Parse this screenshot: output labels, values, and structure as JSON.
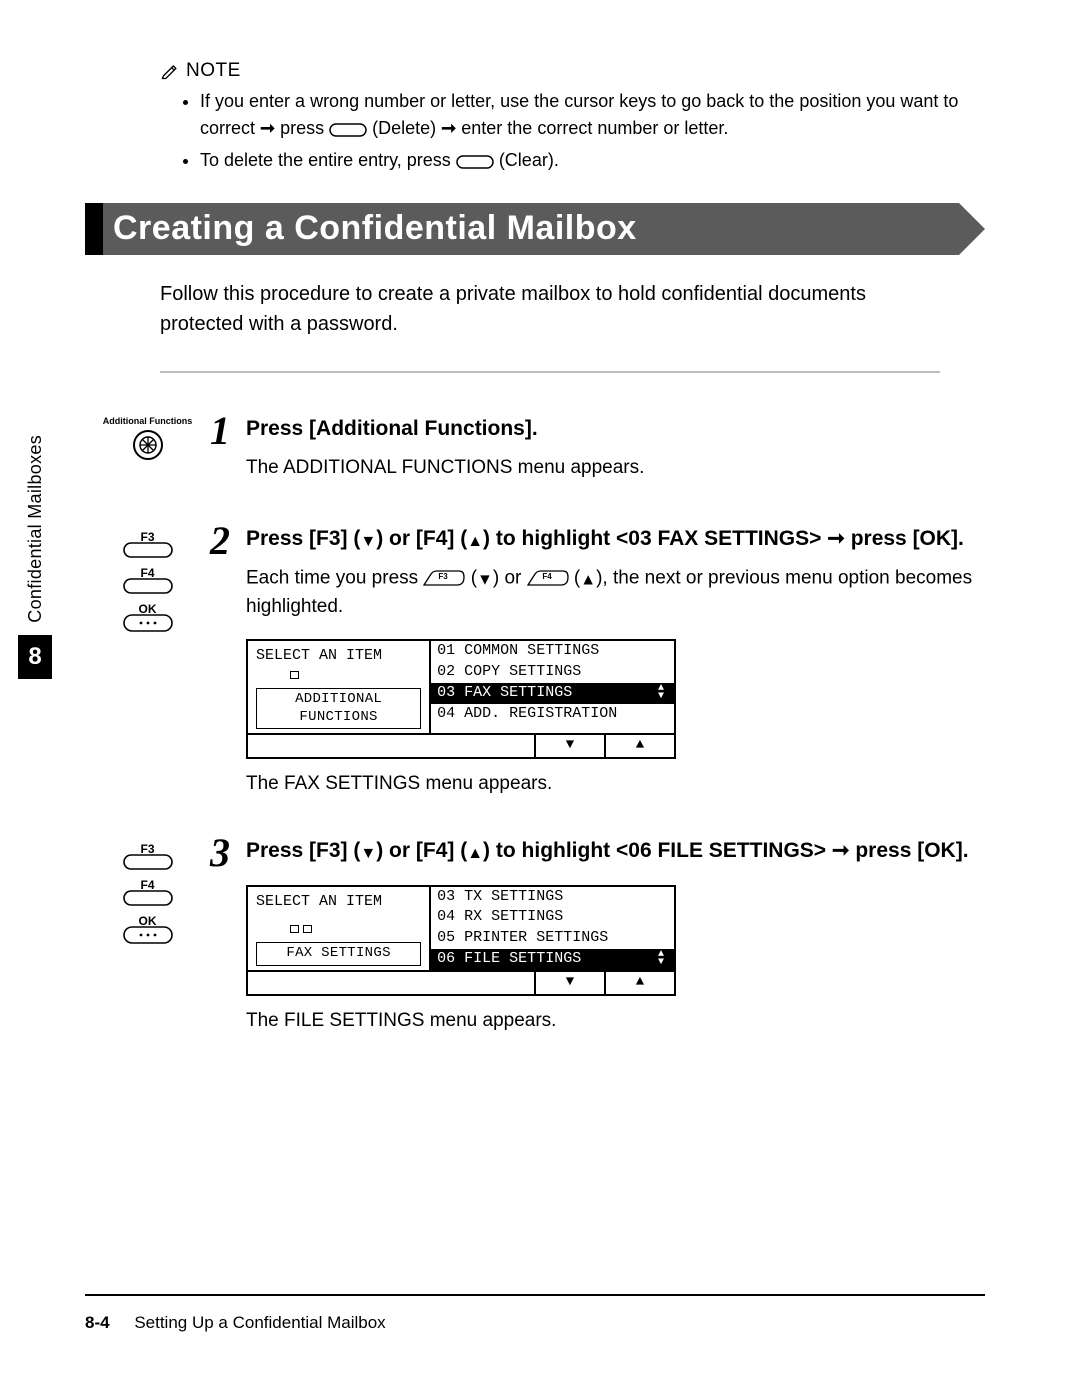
{
  "note": {
    "label": "NOTE",
    "bullet1_a": "If you enter a wrong number or letter, use the cursor keys to go back to the position you want to correct ",
    "bullet1_b": " press ",
    "bullet1_c": " (Delete) ",
    "bullet1_d": " enter the correct number or letter.",
    "bullet2_a": "To delete the entire entry, press ",
    "bullet2_b": " (Clear)."
  },
  "section_title": "Creating a Confidential Mailbox",
  "intro": "Follow this procedure to create a private mailbox to hold confidential documents protected with a password.",
  "icons": {
    "additional_functions_label": "Additional Functions",
    "f3": "F3",
    "f4": "F4",
    "ok": "OK"
  },
  "steps": {
    "s1": {
      "num": "1",
      "heading": "Press [Additional Functions].",
      "text": "The ADDITIONAL FUNCTIONS menu appears."
    },
    "s2": {
      "num": "2",
      "heading_a": "Press [F3] (",
      "heading_b": ") or [F4] (",
      "heading_c": ") to highlight <03 FAX SETTINGS> ",
      "heading_d": " press [OK].",
      "text_a": "Each time you press ",
      "text_b": " (",
      "text_c": ") or ",
      "text_d": " (",
      "text_e": "), the next or previous menu option becomes highlighted.",
      "after": "The FAX SETTINGS menu appears."
    },
    "s3": {
      "num": "3",
      "heading_a": "Press [F3] (",
      "heading_b": ") or [F4] (",
      "heading_c": ") to highlight <06 FILE SETTINGS> ",
      "heading_d": " press [OK].",
      "after": "The FILE SETTINGS menu appears."
    }
  },
  "lcd1": {
    "left_top": "SELECT AN ITEM",
    "left_bottom": "ADDITIONAL FUNCTIONS",
    "r1": "01 COMMON SETTINGS",
    "r2": "02 COPY SETTINGS",
    "r3": "03 FAX SETTINGS",
    "r4": "04 ADD. REGISTRATION"
  },
  "lcd2": {
    "left_top": "SELECT AN ITEM",
    "left_bottom": "FAX SETTINGS",
    "r1": "03 TX SETTINGS",
    "r2": "04 RX SETTINGS",
    "r3": "05 PRINTER SETTINGS",
    "r4": "06 FILE SETTINGS"
  },
  "side": {
    "text": "Confidential Mailboxes",
    "num": "8"
  },
  "footer": {
    "page": "8-4",
    "title": "Setting Up a Confidential Mailbox"
  },
  "glyphs": {
    "arrow_right": "➞",
    "tri_down": "▼",
    "tri_up": "▲"
  }
}
